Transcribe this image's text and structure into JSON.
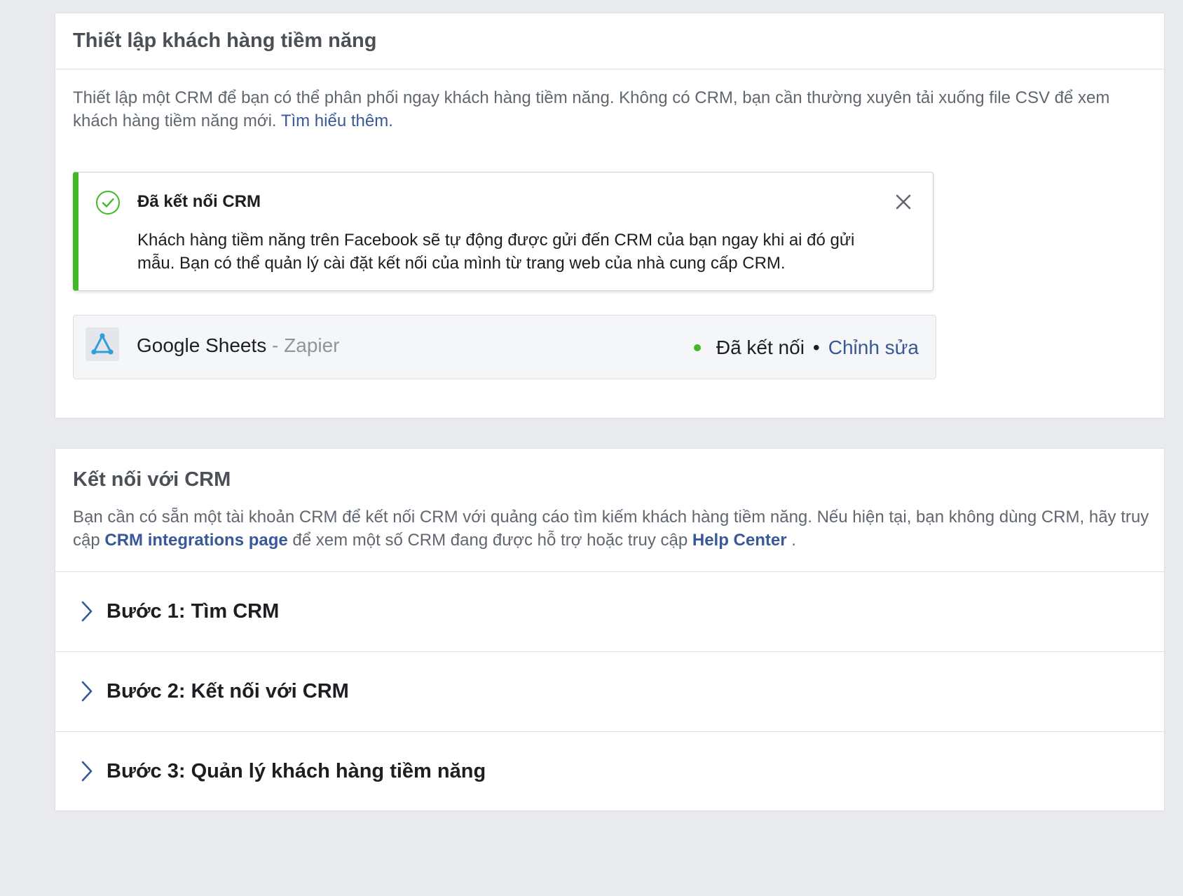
{
  "setup": {
    "title": "Thiết lập khách hàng tiềm năng",
    "description": "Thiết lập một CRM để bạn có thể phân phối ngay khách hàng tiềm năng. Không có CRM, bạn cần thường xuyên tải xuống file CSV để xem khách hàng tiềm năng mới.",
    "learn_more": "Tìm hiểu thêm."
  },
  "notice": {
    "icon": "check-circle-icon",
    "title": "Đã kết nối CRM",
    "body": "Khách hàng tiềm năng trên Facebook sẽ tự động được gửi đến CRM của bạn ngay khi ai đó gửi mẫu. Bạn có thể quản lý cài đặt kết nối của mình từ trang web của nhà cung cấp CRM.",
    "accent_color": "#42b72a"
  },
  "integration": {
    "name": "Google Sheets",
    "separator": " - ",
    "provider": "Zapier",
    "status": "Đã kết nối",
    "bullet": "•",
    "edit_label": "Chỉnh sửa",
    "status_color": "#42b72a"
  },
  "connect": {
    "title": "Kết nối với CRM",
    "desc_part1": "Bạn cần có sẵn một tài khoản CRM để kết nối CRM với quảng cáo tìm kiếm khách hàng tiềm năng. Nếu hiện tại, bạn không dùng CRM, hãy truy cập ",
    "integrations_link": "CRM integrations page",
    "desc_part2": " để xem một số CRM đang được hỗ trợ hoặc truy cập ",
    "help_link": "Help Center",
    "desc_part3": " .",
    "steps": [
      {
        "label": "Bước 1: Tìm CRM"
      },
      {
        "label": "Bước 2: Kết nối với CRM"
      },
      {
        "label": "Bước 3: Quản lý khách hàng tiềm năng"
      }
    ]
  },
  "colors": {
    "link": "#385898",
    "background": "#e9eaed"
  }
}
